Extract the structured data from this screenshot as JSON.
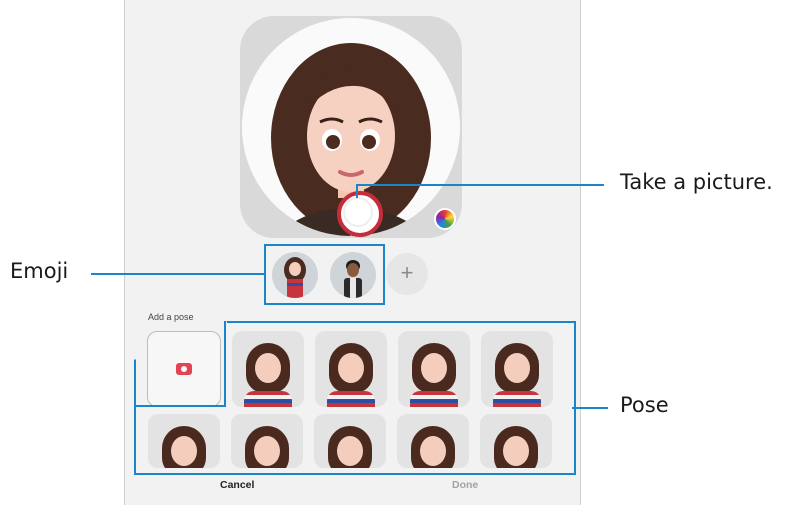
{
  "pose_panel": {
    "add_pose_label": "Add a pose"
  },
  "bottom_bar": {
    "cancel_label": "Cancel",
    "done_label": "Done"
  },
  "emoji_selector": {
    "add_label": "+"
  },
  "callouts": {
    "take_picture": "Take a picture.",
    "emoji": "Emoji",
    "pose": "Pose"
  },
  "colors": {
    "shutter_ring": "#c72c3a",
    "annotation": "#1a85c8",
    "camera_icon": "#e34452"
  }
}
